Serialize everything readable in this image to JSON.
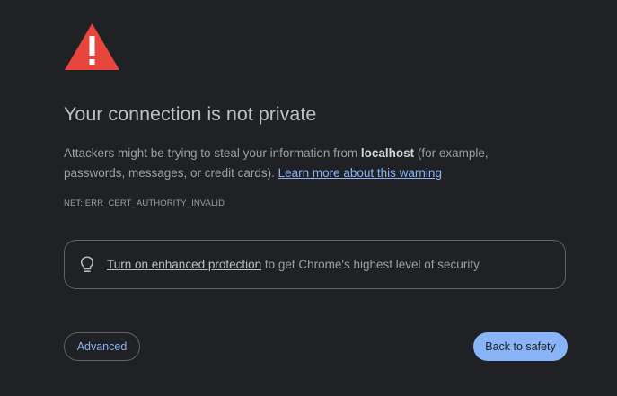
{
  "title": "Your connection is not private",
  "description": {
    "prefix": "Attackers might be trying to steal your information from ",
    "host": "localhost",
    "suffix": " (for example, passwords, messages, or credit cards). ",
    "learn_more": "Learn more about this warning"
  },
  "error_code": "NET::ERR_CERT_AUTHORITY_INVALID",
  "enhanced_protection": {
    "link_text": "Turn on enhanced protection",
    "rest_text": " to get Chrome's highest level of security"
  },
  "buttons": {
    "advanced": "Advanced",
    "back_to_safety": "Back to safety"
  },
  "colors": {
    "background": "#202124",
    "warning": "#e8453c",
    "accent": "#8ab4f8",
    "text": "#bdc1c6"
  },
  "icons": {
    "warning": "warning-triangle-icon",
    "bulb": "lightbulb-icon"
  }
}
